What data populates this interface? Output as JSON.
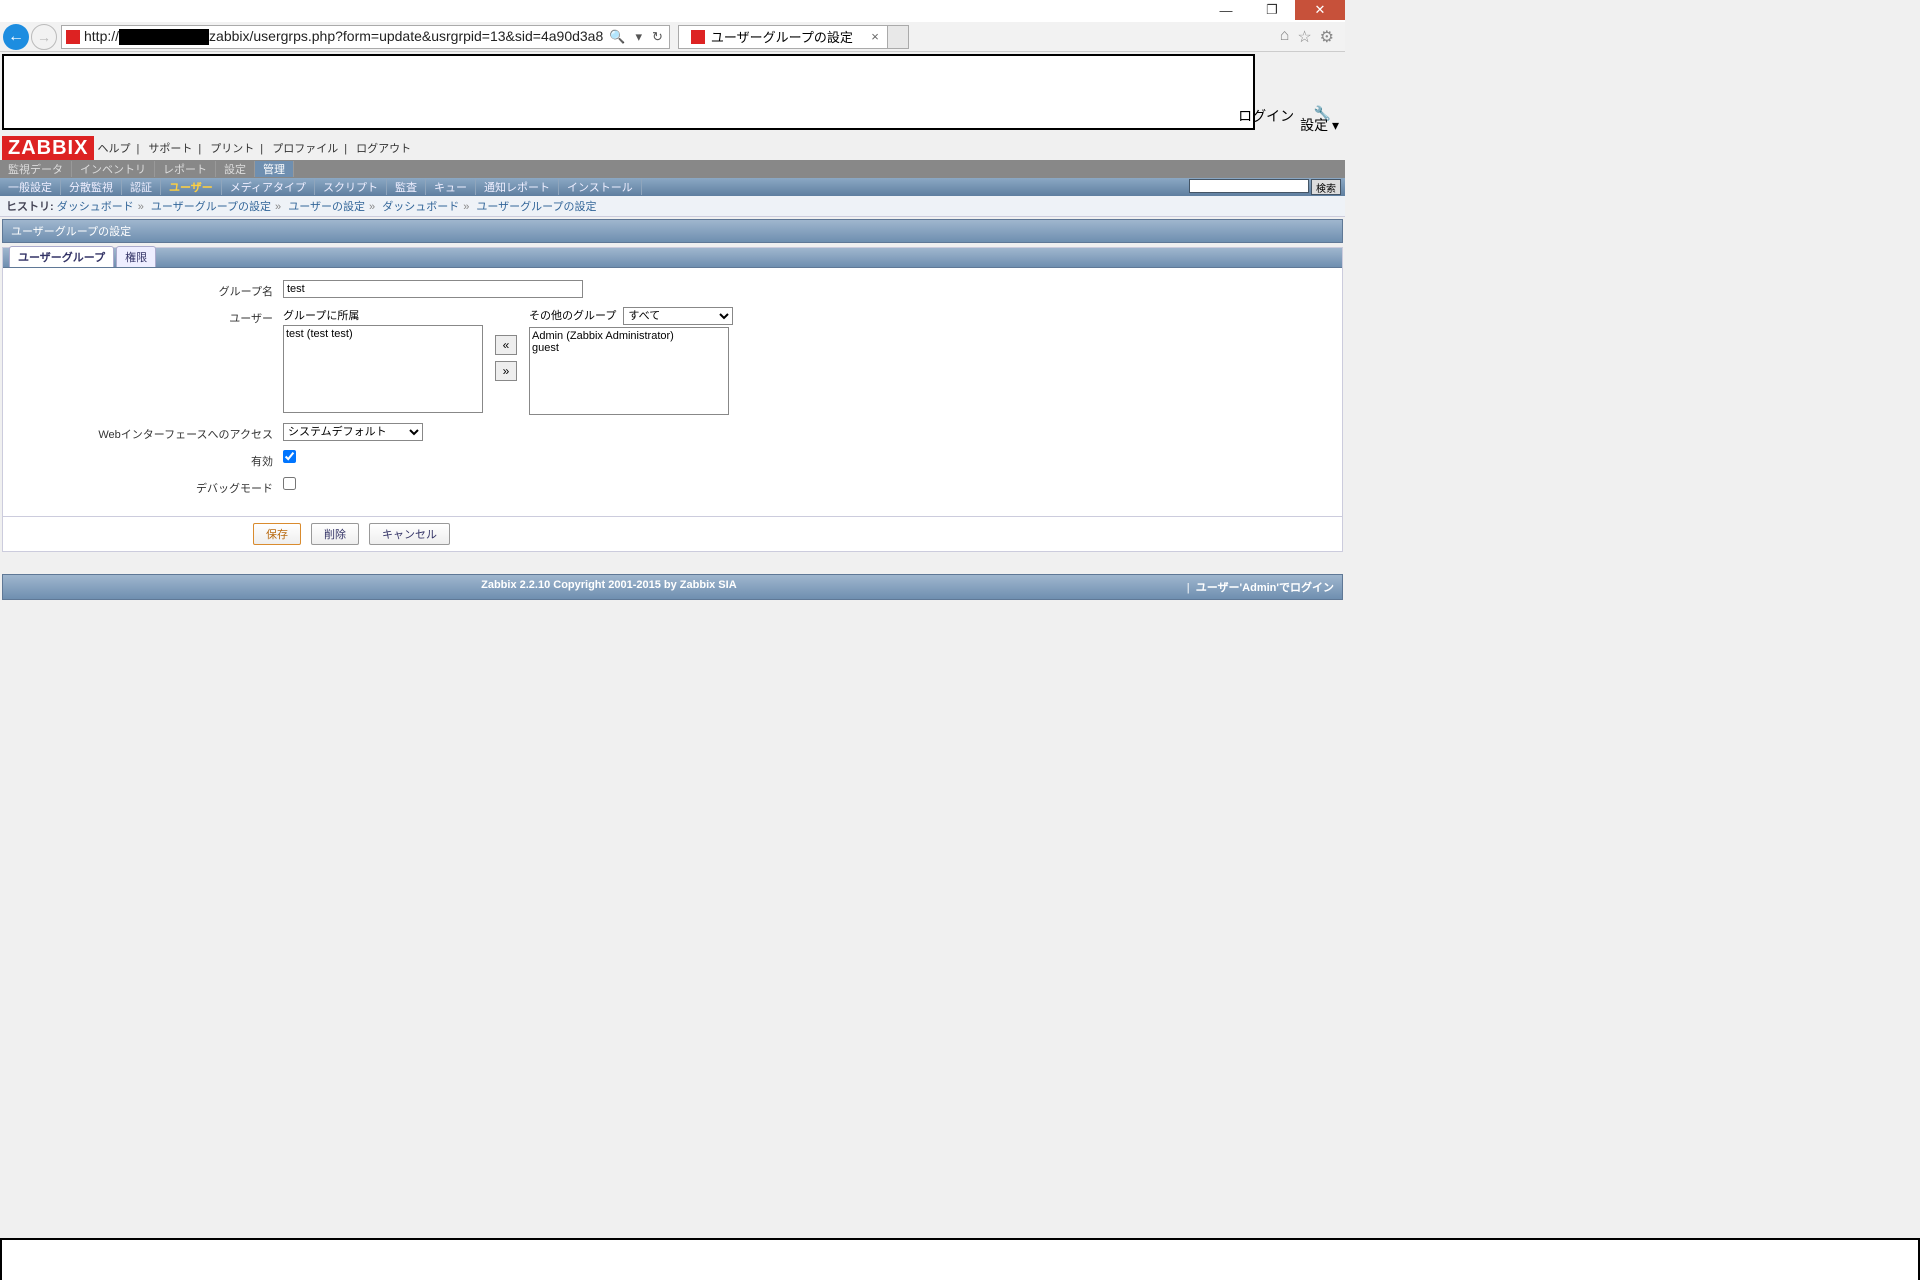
{
  "window": {
    "min": "—",
    "max": "❐",
    "close": "✕"
  },
  "browser": {
    "url_prefix": "http://",
    "url_suffix": "zabbix/usergrps.php?form=update&usrgrpid=13&sid=4a90d3a8",
    "tab_title": "ユーザーグループの設定",
    "search_indicator": "🔍",
    "refresh": "↻",
    "dropdown": "▾"
  },
  "top_right": {
    "login": "ログイン",
    "settings": "設定",
    "caret": "▾"
  },
  "zbx": {
    "logo": "ZABBIX"
  },
  "helpbar": {
    "help": "ヘルプ",
    "support": "サポート",
    "print": "プリント",
    "profile": "プロファイル",
    "logout": "ログアウト",
    "sep": "|"
  },
  "nav1": {
    "i0": "監視データ",
    "i1": "インベントリ",
    "i2": "レポート",
    "i3": "設定",
    "i4": "管理"
  },
  "nav2": {
    "i0": "一般設定",
    "i1": "分散監視",
    "i2": "認証",
    "i3": "ユーザー",
    "i4": "メディアタイプ",
    "i5": "スクリプト",
    "i6": "監査",
    "i7": "キュー",
    "i8": "通知レポート",
    "i9": "インストール",
    "search_btn": "検索"
  },
  "history": {
    "label": "ヒストリ:",
    "i0": "ダッシュボード",
    "i1": "ユーザーグループの設定",
    "i2": "ユーザーの設定",
    "i3": "ダッシュボード",
    "i4": "ユーザーグループの設定",
    "sep": "»"
  },
  "section": {
    "title": "ユーザーグループの設定"
  },
  "tabs": {
    "t0": "ユーザーグループ",
    "t1": "権限"
  },
  "form": {
    "group_name_label": "グループ名",
    "group_name_value": "test",
    "users_label": "ユーザー",
    "in_group_label": "グループに所属",
    "in_group_item0": "test (test test)",
    "other_label": "その他のグループ",
    "other_select": "すべて",
    "other_item0": "Admin (Zabbix Administrator)",
    "other_item1": "guest",
    "btn_left": "«",
    "btn_right": "»",
    "web_access_label": "Webインターフェースへのアクセス",
    "web_access_value": "システムデフォルト",
    "enabled_label": "有効",
    "debug_label": "デバッグモード"
  },
  "buttons": {
    "save": "保存",
    "delete": "削除",
    "cancel": "キャンセル"
  },
  "footer": {
    "copyright": "Zabbix 2.2.10 Copyright 2001-2015 by Zabbix SIA",
    "logged": "ユーザー'Admin'でログイン",
    "sep": "|"
  }
}
